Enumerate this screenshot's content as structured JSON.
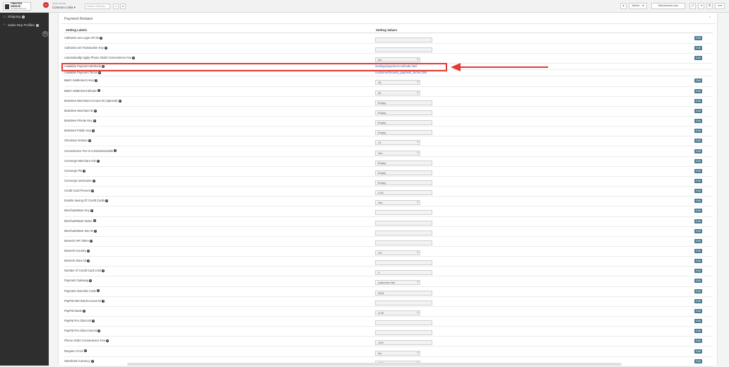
{
  "topbar": {
    "logo_line1": "PRINTER",
    "logo_line2": "BRIDGE",
    "logo_sub": "The Web-to-Print Co.",
    "notif_count": "99",
    "quick_access_label": "Quick Access",
    "quick_access_value": "Common Links",
    "search_placeholder": "Search Order(s)",
    "search_icon": "⌕",
    "dropdown_icon": "▾",
    "user_menu": "Admin...",
    "site_url": "fullcolornow.com"
  },
  "sidebar": {
    "items": [
      {
        "label": "Shipping",
        "icon": "truck-icon"
      },
      {
        "label": "Sales Rep Profiles",
        "icon": "headset-icon"
      }
    ]
  },
  "panel": {
    "title": "Payment Related",
    "col_labels": "Setting Labels",
    "col_values": "Setting Values",
    "edit_label": "Edit",
    "rows": [
      {
        "label": "Authorize.net Login API ID",
        "type": "box",
        "value": "",
        "edit": true
      },
      {
        "label": "Authorize.net Transaction Key",
        "type": "box",
        "value": "",
        "edit": true
      },
      {
        "label": "Automatically Apply Phone Order Convenience Fee",
        "type": "select",
        "value": "No",
        "edit": true
      },
      {
        "label": "Available Payment Methods",
        "type": "link",
        "value": "/settings/payment-methods.html",
        "edit": false
      },
      {
        "label": "Available Payment Terms",
        "type": "link",
        "value": "/customer/browse_payment_terms.html",
        "edit": false
      },
      {
        "label": "Batch Settlement Hour",
        "type": "select",
        "value": "18",
        "edit": true
      },
      {
        "label": "Batch Settlement Minute",
        "type": "select",
        "value": "30",
        "edit": true
      },
      {
        "label": "Braintree Merchant Account ID (optional)",
        "type": "box",
        "value": "Empty",
        "edit": true
      },
      {
        "label": "Braintree Merchant ID",
        "type": "box",
        "value": "Empty",
        "edit": true
      },
      {
        "label": "Braintree Private Key",
        "type": "box",
        "value": "Empty",
        "edit": true
      },
      {
        "label": "Braintree Public Key",
        "type": "box",
        "value": "Empty",
        "edit": true
      },
      {
        "label": "Checkout Version",
        "type": "select",
        "value": "V1",
        "edit": true
      },
      {
        "label": "Convenience Fee is Commissionable",
        "type": "select",
        "value": "Yes",
        "edit": true
      },
      {
        "label": "Converge Merchant A/D",
        "type": "box",
        "value": "Empty",
        "edit": true
      },
      {
        "label": "Converge Pin",
        "type": "box",
        "value": "Empty",
        "edit": true
      },
      {
        "label": "Converge Username",
        "type": "box",
        "value": "Empty",
        "edit": true
      },
      {
        "label": "Credit Card Percent",
        "type": "box",
        "value": "3.00",
        "edit": true
      },
      {
        "label": "Enable Saving Of Credit Cards",
        "type": "select",
        "value": "Yes",
        "edit": true
      },
      {
        "label": "MerchantWare Key",
        "type": "box",
        "value": "",
        "edit": true
      },
      {
        "label": "MerchantWare Name",
        "type": "box",
        "value": "",
        "edit": true
      },
      {
        "label": "MerchantWare Site ID",
        "type": "box",
        "value": "",
        "edit": true
      },
      {
        "label": "Moneris API Token",
        "type": "box",
        "value": "",
        "edit": true
      },
      {
        "label": "Moneris Country",
        "type": "select",
        "value": "CA",
        "edit": true
      },
      {
        "label": "Moneris Store ID",
        "type": "box",
        "value": "",
        "edit": true
      },
      {
        "label": "Number of Credit Card Limit",
        "type": "box",
        "value": "3",
        "edit": true
      },
      {
        "label": "Payment Gateway",
        "type": "select",
        "value": "Authorize.Net",
        "edit": true
      },
      {
        "label": "Payment Override Code",
        "type": "box",
        "value": "4021",
        "edit": true
      },
      {
        "label": "PayPal MerchantAccount ID",
        "type": "box",
        "value": "",
        "edit": true
      },
      {
        "label": "PayPal Mode",
        "type": "select",
        "value": "LIVE",
        "edit": true
      },
      {
        "label": "PayPal Pro Client ID",
        "type": "box",
        "value": "",
        "edit": true
      },
      {
        "label": "PayPal Pro Client Secret",
        "type": "box",
        "value": "",
        "edit": true
      },
      {
        "label": "Phone Order Convenience Fee",
        "type": "box",
        "value": "10%",
        "edit": true
      },
      {
        "label": "Require CVV2",
        "type": "select",
        "value": "No",
        "edit": true
      },
      {
        "label": "Storefront Currency",
        "type": "select",
        "value": "USD",
        "edit": true
      }
    ]
  },
  "colors": {
    "highlight": "#e53935",
    "edit_button": "#4d7d91",
    "link": "#2a5db0",
    "sidebar": "#2e2e2e"
  }
}
